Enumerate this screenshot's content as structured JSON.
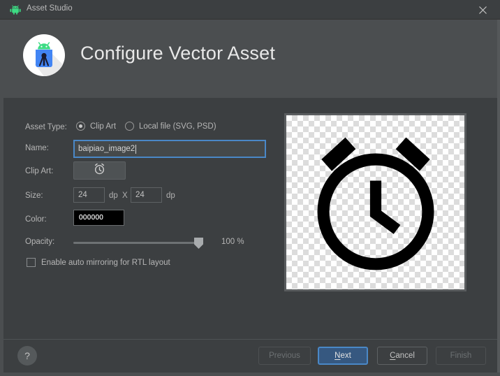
{
  "window": {
    "title": "Asset Studio",
    "icon": "android-robot-icon",
    "close_label": "close-icon"
  },
  "header": {
    "title": "Configure Vector Asset",
    "icon": "android-studio-icon"
  },
  "form": {
    "asset_type": {
      "label": "Asset Type:",
      "options": [
        {
          "label": "Clip Art",
          "selected": true
        },
        {
          "label": "Local file (SVG, PSD)",
          "selected": false
        }
      ]
    },
    "name": {
      "label": "Name:",
      "value": "baipiao_image2",
      "placeholder": ""
    },
    "clip_art": {
      "label": "Clip Art:",
      "icon": "alarm-clock-icon"
    },
    "size": {
      "label": "Size:",
      "width": "24",
      "height": "24",
      "unit": "dp",
      "separator": "X"
    },
    "color": {
      "label": "Color:",
      "value": "000000",
      "hex": "#000000"
    },
    "opacity": {
      "label": "Opacity:",
      "value": 100,
      "display": "100 %",
      "min": 0,
      "max": 100
    },
    "mirroring": {
      "label": "Enable auto mirroring for RTL layout",
      "checked": false
    }
  },
  "preview": {
    "icon": "alarm-clock-icon",
    "background": "transparency-checkerboard"
  },
  "footer": {
    "help_label": "?",
    "buttons": [
      {
        "label": "Previous",
        "state": "disabled"
      },
      {
        "label": "Next",
        "state": "primary",
        "mnemonic": "N"
      },
      {
        "label": "Cancel",
        "state": "default",
        "mnemonic": "C"
      },
      {
        "label": "Finish",
        "state": "disabled"
      }
    ]
  },
  "colors": {
    "accent": "#4a88c7",
    "primary_button": "#365880",
    "titlebar": "#3c3f41",
    "header_band": "#4b4e50",
    "body": "#3c3f41"
  }
}
